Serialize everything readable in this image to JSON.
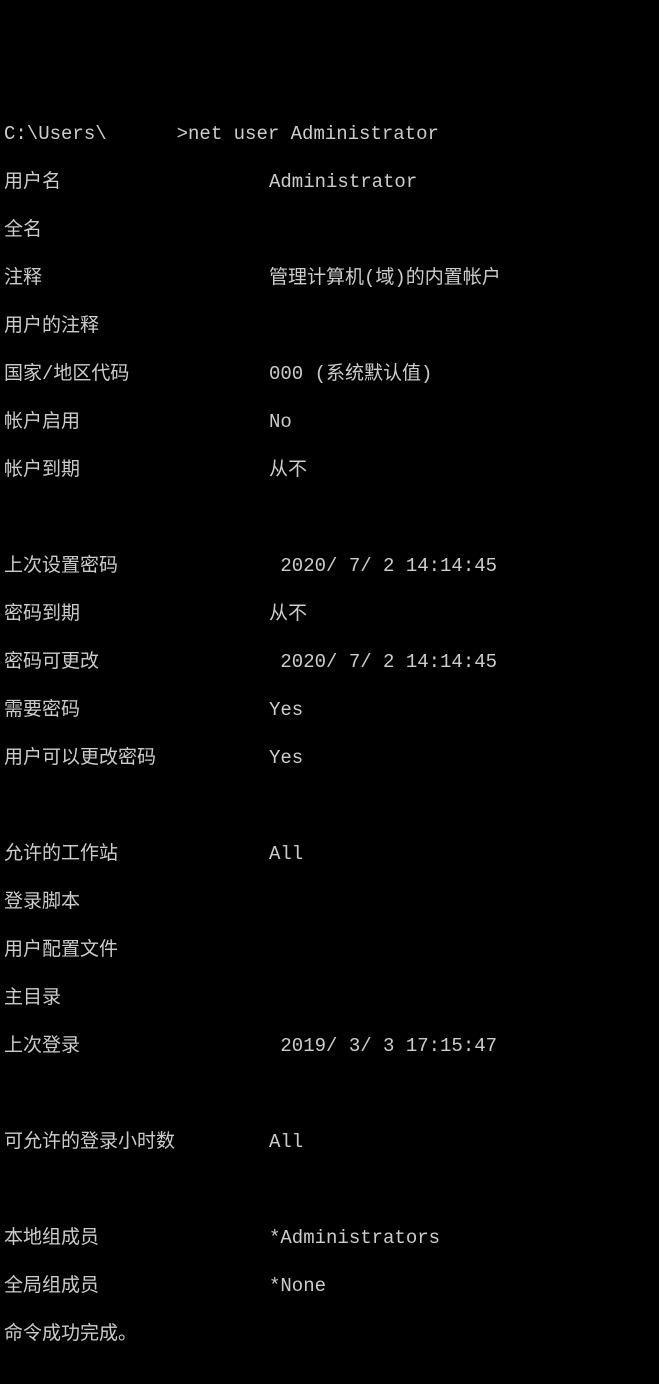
{
  "prompt": {
    "path_prefix": "C:\\Users\\",
    "path_suffix": ">",
    "command": "net user Administrator"
  },
  "fields": {
    "username": {
      "label": "用户名",
      "value": "Administrator"
    },
    "fullname": {
      "label": "全名",
      "value": ""
    },
    "comment": {
      "label": "注释",
      "value": "管理计算机(域)的内置帐户"
    },
    "user_comment": {
      "label": "用户的注释",
      "value": ""
    },
    "country_code": {
      "label": "国家/地区代码",
      "value": "000 (系统默认值)"
    },
    "account_active": {
      "label": "帐户启用",
      "value": "No"
    },
    "account_expires": {
      "label": "帐户到期",
      "value": "从不"
    },
    "password_last_set": {
      "label": "上次设置密码",
      "value": " 2020/ 7/ 2 14:14:45"
    },
    "password_expires": {
      "label": "密码到期",
      "value": "从不"
    },
    "password_changeable": {
      "label": "密码可更改",
      "value": " 2020/ 7/ 2 14:14:45"
    },
    "password_required": {
      "label": "需要密码",
      "value": "Yes"
    },
    "user_may_change_pw": {
      "label": "用户可以更改密码",
      "value": "Yes"
    },
    "workstations": {
      "label": "允许的工作站",
      "value": "All"
    },
    "logon_script": {
      "label": "登录脚本",
      "value": ""
    },
    "user_profile": {
      "label": "用户配置文件",
      "value": ""
    },
    "home_dir": {
      "label": "主目录",
      "value": ""
    },
    "last_logon": {
      "label": "上次登录",
      "value": " 2019/ 3/ 3 17:15:47"
    },
    "logon_hours": {
      "label": "可允许的登录小时数",
      "value": "All"
    },
    "local_groups": {
      "label": "本地组成员",
      "value": "*Administrators"
    },
    "global_groups": {
      "label": "全局组成员",
      "value": "*None"
    }
  },
  "completion": "命令成功完成。"
}
